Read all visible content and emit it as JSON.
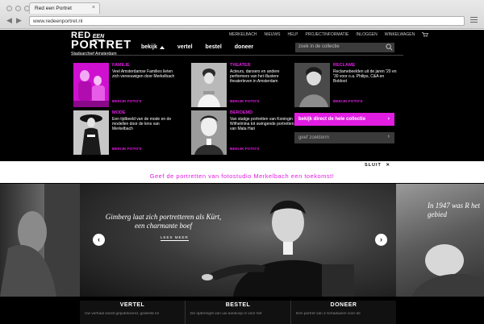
{
  "browser": {
    "tab_title": "Red een Portret",
    "tab_close": "×",
    "url": "www.redeenportret.nl",
    "back": "◀",
    "forward": "▶"
  },
  "header": {
    "logo_red": "RED",
    "logo_een": "EEN",
    "logo_portret": "PORTRET",
    "logo_sub": "Stadsarchief Amsterdam",
    "topnav": [
      "MERKELBACH",
      "NIEUWS",
      "HELP",
      "PROJECTINFORMATIE",
      "INLOGGEN",
      "WINKELWAGEN"
    ],
    "mainnav": [
      "bekijk",
      "vertel",
      "bestel",
      "doneer"
    ],
    "search_placeholder": "zoek in de collectie"
  },
  "categories": [
    {
      "title": "FAMILIE",
      "desc": "Veel Amsterdamse Families lieten zich vereeuwigen door Merkelbach",
      "more": "BEKIJK FOTO'S"
    },
    {
      "title": "THEATER",
      "desc": "Acteurs, dansers en andere performers van het illustere theaterleven in Amsterdam",
      "more": "BEKIJK FOTO'S"
    },
    {
      "title": "RECLAME",
      "desc": "Reclamebeelden uit de jaren '20 en '30 voor o.a. Philips, C&A en Boldoot",
      "more": "BEKIJK FOTO'S"
    },
    {
      "title": "MODE",
      "desc": "Een tijdbeeld van de mode en de modellen door de lens van Merkelbach",
      "more": "BEKIJK FOTO'S"
    },
    {
      "title": "BEROEMD",
      "desc": "Van statige portretten van Koningin Wilhelmina tot swingende portretten van Mata Hari",
      "more": "BEKIJK FOTO'S"
    }
  ],
  "cta": {
    "collection": "bekijk direct de hele collectie",
    "search_term": "geef zoekterm",
    "arrow": "›"
  },
  "close_label": "SLUIT",
  "close_icon": "✕",
  "promo": "Geef de portretten van fotostudio Merkelbach een toekomst!",
  "hero": {
    "quote": "Gimberg laat zich portretteren als Kürt, een charmante boef",
    "read_more": "LEES MEER",
    "side_quote": "In 1947 was R het gebied",
    "prev": "‹",
    "next": "›"
  },
  "bottom": [
    {
      "heading": "VERTEL",
      "text": "Uw verhaal wordt gepubliceerd, gedeeld en"
    },
    {
      "heading": "BESTEL",
      "text": "De opbrengst van uw aankoop is voor het"
    },
    {
      "heading": "DONEER",
      "text": "Een portret van 2 schaduwen voor de"
    }
  ],
  "colors": {
    "accent": "#e11de1",
    "background": "#000000"
  }
}
